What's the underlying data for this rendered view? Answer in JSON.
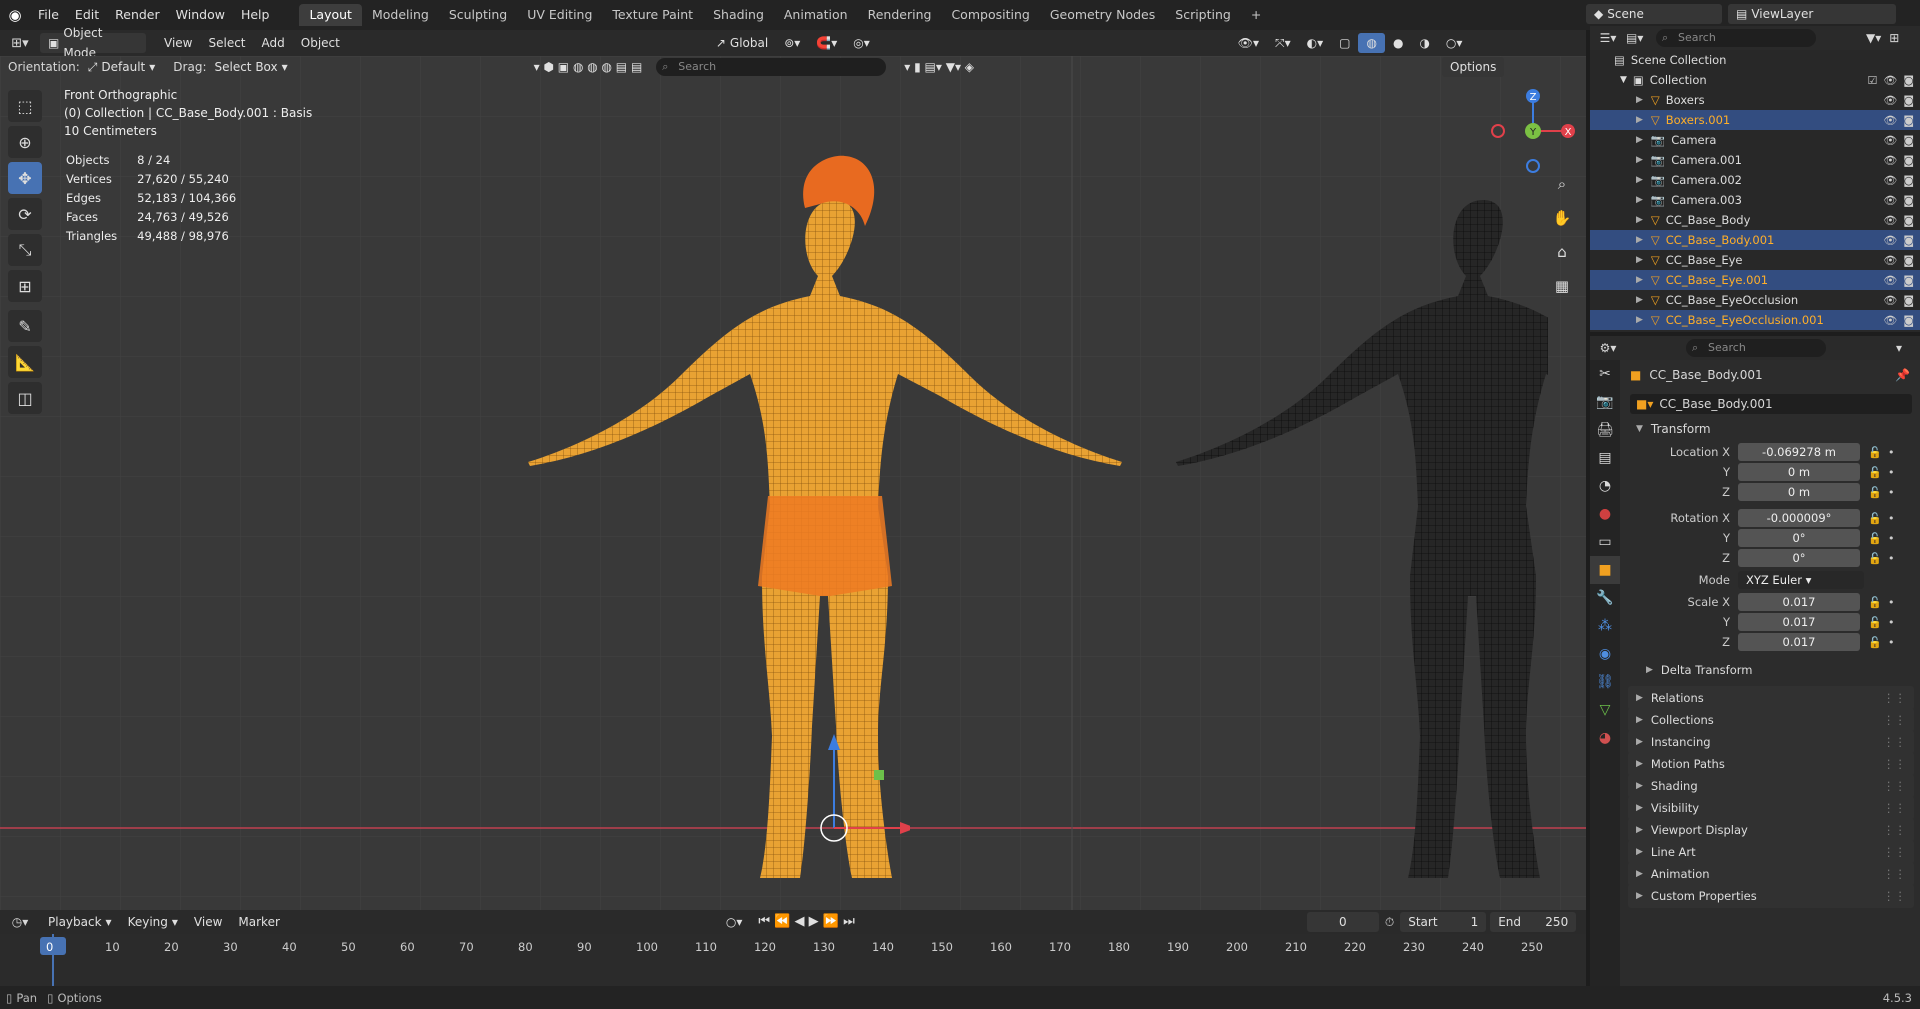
{
  "topbar": {
    "menus": [
      "File",
      "Edit",
      "Render",
      "Window",
      "Help"
    ],
    "workspaces": [
      "Layout",
      "Modeling",
      "Sculpting",
      "UV Editing",
      "Texture Paint",
      "Shading",
      "Animation",
      "Rendering",
      "Compositing",
      "Geometry Nodes",
      "Scripting"
    ],
    "active_workspace": "Layout",
    "scene": "Scene",
    "view_layer": "ViewLayer"
  },
  "viewport_header": {
    "mode": "Object Mode",
    "menus": [
      "View",
      "Select",
      "Add",
      "Object"
    ],
    "transform_orientation": "Global",
    "options": "Options"
  },
  "sub_header": {
    "orientation_label": "Orientation:",
    "orientation_value": "Default",
    "drag_label": "Drag:",
    "drag_value": "Select Box",
    "search_placeholder": "Search"
  },
  "viewport": {
    "view_name": "Front Orthographic",
    "collection_info": "(0) Collection | CC_Base_Body.001 : Basis",
    "scale": "10 Centimeters",
    "stats": [
      [
        "Objects",
        "8 / 24"
      ],
      [
        "Vertices",
        "27,620 / 55,240"
      ],
      [
        "Edges",
        "52,183 / 104,366"
      ],
      [
        "Faces",
        "24,763 / 49,526"
      ],
      [
        "Triangles",
        "49,488 / 98,976"
      ]
    ],
    "gizmo": {
      "z": "Z",
      "y": "Y",
      "x": "X"
    },
    "active_color": "#f0a020",
    "inactive_color": "#111111"
  },
  "outliner": {
    "search_placeholder": "Search",
    "root": "Scene Collection",
    "collection": "Collection",
    "items": [
      {
        "name": "Boxers",
        "type": "mesh",
        "selected": false
      },
      {
        "name": "Boxers.001",
        "type": "mesh",
        "selected": true
      },
      {
        "name": "Camera",
        "type": "camera",
        "selected": false
      },
      {
        "name": "Camera.001",
        "type": "camera",
        "selected": false
      },
      {
        "name": "Camera.002",
        "type": "camera",
        "selected": false
      },
      {
        "name": "Camera.003",
        "type": "camera",
        "selected": false
      },
      {
        "name": "CC_Base_Body",
        "type": "mesh",
        "selected": false
      },
      {
        "name": "CC_Base_Body.001",
        "type": "mesh",
        "selected": true
      },
      {
        "name": "CC_Base_Eye",
        "type": "mesh",
        "selected": false
      },
      {
        "name": "CC_Base_Eye.001",
        "type": "mesh",
        "selected": true
      },
      {
        "name": "CC_Base_EyeOcclusion",
        "type": "mesh",
        "selected": false
      },
      {
        "name": "CC_Base_EyeOcclusion.001",
        "type": "mesh",
        "selected": true
      }
    ]
  },
  "properties": {
    "search_placeholder": "Search",
    "object_name": "CC_Base_Body.001",
    "datablock": "CC_Base_Body.001",
    "transform_title": "Transform",
    "location": {
      "label": "Location X",
      "x": "-0.069278 m",
      "y": "0 m",
      "z": "0 m"
    },
    "rotation": {
      "label": "Rotation X",
      "x": "-0.000009°",
      "y": "0°",
      "z": "0°"
    },
    "mode_label": "Mode",
    "mode_value": "XYZ Euler",
    "scale": {
      "label": "Scale X",
      "x": "0.017",
      "y": "0.017",
      "z": "0.017"
    },
    "axis_y": "Y",
    "axis_z": "Z",
    "delta": "Delta Transform",
    "panels": [
      "Relations",
      "Collections",
      "Instancing",
      "Motion Paths",
      "Shading",
      "Visibility",
      "Viewport Display",
      "Line Art",
      "Animation",
      "Custom Properties"
    ]
  },
  "timeline": {
    "menus": [
      "Playback",
      "Keying",
      "View",
      "Marker"
    ],
    "current_frame": "0",
    "start_label": "Start",
    "start": "1",
    "end_label": "End",
    "end": "250",
    "ticks": [
      "0",
      "10",
      "20",
      "30",
      "40",
      "50",
      "60",
      "70",
      "80",
      "90",
      "100",
      "110",
      "120",
      "130",
      "140",
      "150",
      "160",
      "170",
      "180",
      "190",
      "200",
      "210",
      "220",
      "230",
      "240",
      "250"
    ]
  },
  "status": {
    "pan": "Pan",
    "options": "Options",
    "version": "4.5.3"
  }
}
